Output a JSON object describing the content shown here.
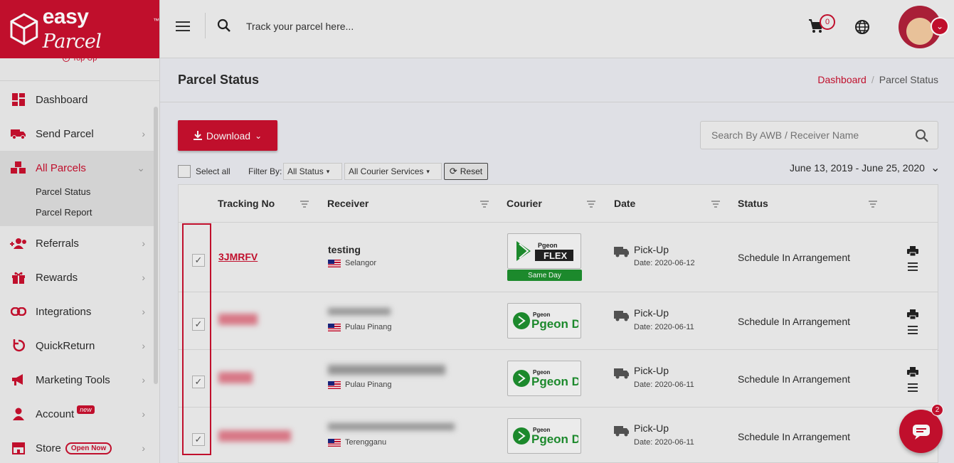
{
  "brand": {
    "name": "easy",
    "name_script": "Parcel",
    "tm": "™",
    "color": "#c8102e"
  },
  "sidebar": {
    "topup": "Top Up",
    "items": [
      {
        "label": "Dashboard",
        "icon": "dashboard-icon"
      },
      {
        "label": "Send Parcel",
        "icon": "truck-icon"
      },
      {
        "label": "All Parcels",
        "icon": "boxes-icon"
      },
      {
        "label": "Referrals",
        "icon": "referrals-icon"
      },
      {
        "label": "Rewards",
        "icon": "gift-icon"
      },
      {
        "label": "Integrations",
        "icon": "link-icon"
      },
      {
        "label": "QuickReturn",
        "icon": "return-icon"
      },
      {
        "label": "Marketing Tools",
        "icon": "megaphone-icon"
      },
      {
        "label": "Account",
        "icon": "user-icon",
        "badge": "new"
      },
      {
        "label": "Store",
        "icon": "store-icon",
        "badge": "Open Now"
      }
    ],
    "sub_items": [
      "Parcel Status",
      "Parcel Report"
    ]
  },
  "topbar": {
    "track_placeholder": "Track your parcel here...",
    "cart_count": "0"
  },
  "page": {
    "title": "Parcel Status",
    "breadcrumb": [
      "Dashboard",
      "Parcel Status"
    ]
  },
  "controls": {
    "download": "Download",
    "search_placeholder": "Search By AWB / Receiver Name",
    "select_all": "Select all",
    "filter_by": "Filter By:",
    "status_filter": "All Status",
    "courier_filter": "All Courier Services",
    "reset": "Reset",
    "date_range": "June 13, 2019 - June 25, 2020"
  },
  "table": {
    "headers": [
      "Tracking No",
      "Receiver",
      "Courier",
      "Date",
      "Status"
    ],
    "rows": [
      {
        "tracking": "3JMRFV",
        "receiver": "testing",
        "state": "Selangor",
        "courier": "Pgeon FLEX",
        "courier_tag": "Same Day",
        "date_type": "Pick-Up",
        "date": "Date: 2020-06-12",
        "status": "Schedule In Arrangement",
        "checked": true
      },
      {
        "tracking": "",
        "receiver": "",
        "state": "Pulau Pinang",
        "courier": "Pgeon Delivery",
        "date_type": "Pick-Up",
        "date": "Date: 2020-06-11",
        "status": "Schedule In Arrangement",
        "checked": true
      },
      {
        "tracking": "",
        "receiver": "",
        "state": "Pulau Pinang",
        "courier": "Pgeon Delivery",
        "date_type": "Pick-Up",
        "date": "Date: 2020-06-11",
        "status": "Schedule In Arrangement",
        "checked": true
      },
      {
        "tracking": "",
        "receiver": "",
        "state": "Terengganu",
        "courier": "Pgeon Delivery",
        "date_type": "Pick-Up",
        "date": "Date: 2020-06-11",
        "status": "Schedule In Arrangement",
        "checked": true
      }
    ]
  },
  "chat": {
    "badge": "2"
  }
}
